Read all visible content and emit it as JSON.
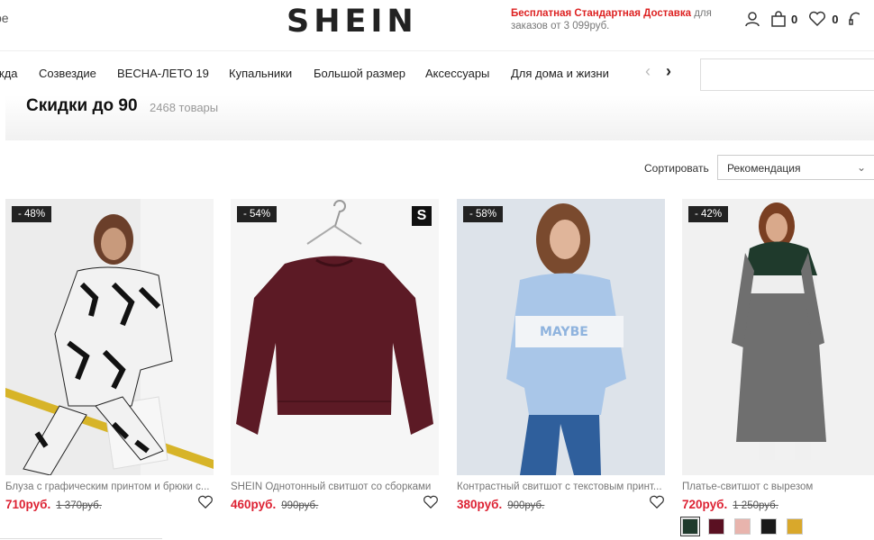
{
  "header": {
    "left_fragment": "ре",
    "logo": "SHEIN",
    "promo_bold": "Бесплатная Стандартная Доставка",
    "promo_rest": " для заказов от 3 099руб.",
    "bag_count": "0",
    "wishlist_count": "0"
  },
  "nav": {
    "items": [
      "жда",
      "Созвездие",
      "ВЕСНА-ЛЕТО 19",
      "Купальники",
      "Большой размер",
      "Аксессуары",
      "Для дома и жизни"
    ],
    "prev_arrow": "‹",
    "next_arrow": "›"
  },
  "category": {
    "title": "Скидки до 90",
    "count": "2468 товары"
  },
  "sort": {
    "label": "Сортировать",
    "value": "Рекомендация"
  },
  "products": [
    {
      "discount": "- 48%",
      "name": "Блуза с графическим принтом и брюки с...",
      "price": "710руб.",
      "old_price": "1 370руб."
    },
    {
      "discount": "- 54%",
      "brand_badge": "S",
      "name": "SHEIN Однотонный свитшот со сборками",
      "price": "460руб.",
      "old_price": "990руб."
    },
    {
      "discount": "- 58%",
      "name": "Контрастный свитшот с текстовым принт...",
      "price": "380руб.",
      "old_price": "900руб."
    },
    {
      "discount": "- 42%",
      "name": "Платье-свитшот с вырезом",
      "price": "720руб.",
      "old_price": "1 250руб."
    }
  ],
  "swatch_colors": [
    "#1f3a2c",
    "#5a1022",
    "#e8b4ad",
    "#1a1a1a",
    "#d9a82b"
  ],
  "colors": {
    "accent": "#d22233",
    "badge": "#222222"
  }
}
